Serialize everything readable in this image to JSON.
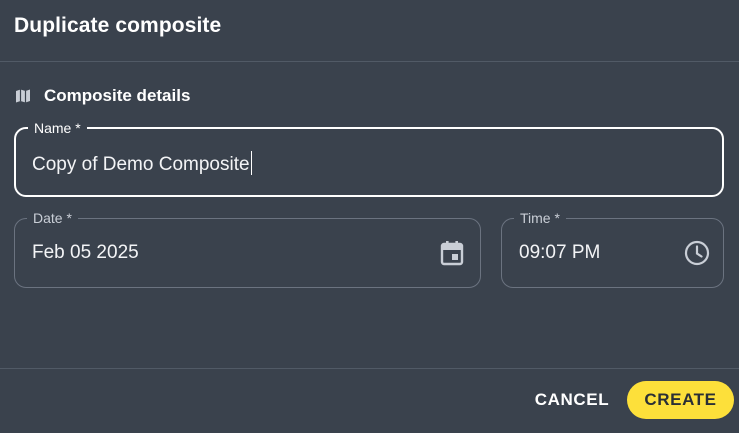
{
  "dialog": {
    "title": "Duplicate composite",
    "section": {
      "icon": "map-icon",
      "title": "Composite details"
    },
    "fields": {
      "name": {
        "label": "Name *",
        "value": "Copy of Demo Composite"
      },
      "date": {
        "label": "Date *",
        "value": "Feb 05 2025",
        "icon": "calendar-icon"
      },
      "time": {
        "label": "Time *",
        "value": "09:07 PM",
        "icon": "clock-icon"
      }
    },
    "actions": {
      "cancel_label": "CANCEL",
      "create_label": "CREATE"
    }
  },
  "colors": {
    "background": "#3a424d",
    "accent": "#fde03a",
    "text": "#ffffff"
  }
}
